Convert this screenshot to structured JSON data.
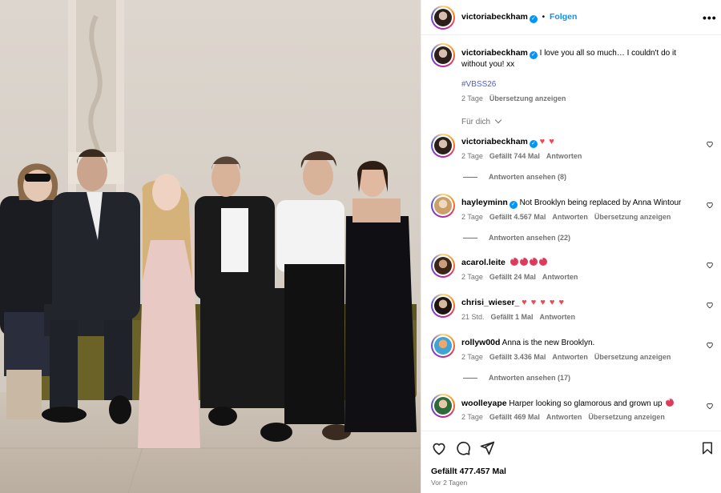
{
  "header": {
    "username": "victoriabeckham",
    "dot": "•",
    "follow_label": "Folgen",
    "more_icon": "more-horizontal-icon"
  },
  "caption": {
    "username": "victoriabeckham",
    "text": "I love you all so much… I couldn't do it without you! xx",
    "hashtag": "#VBSS26",
    "time": "2 Tage",
    "translate_label": "Übersetzung anzeigen"
  },
  "sort": {
    "label": "Für dich"
  },
  "comments": [
    {
      "username": "victoriabeckham",
      "verified": true,
      "text": "",
      "emoji": "♥ ♥",
      "time": "2 Tage",
      "likes": "Gefällt 744 Mal",
      "reply": "Antworten",
      "translate": "",
      "replies": "Antworten ansehen (8)"
    },
    {
      "username": "hayleyminn",
      "verified": true,
      "text": "Not Brooklyn being replaced by Anna Wintour",
      "emoji": "",
      "time": "2 Tage",
      "likes": "Gefällt 4.567 Mal",
      "reply": "Antworten",
      "translate": "Übersetzung anzeigen",
      "replies": "Antworten ansehen (22)"
    },
    {
      "username": "acarol.leite",
      "verified": false,
      "text": "",
      "emoji": "😍😍😍😍",
      "time": "2 Tage",
      "likes": "Gefällt 24 Mal",
      "reply": "Antworten",
      "translate": "",
      "replies": ""
    },
    {
      "username": "chrisi_wieser_",
      "verified": false,
      "text": "",
      "emoji": "♥ ♥ ♥ ♥ ♥",
      "time": "21 Std.",
      "likes": "Gefällt 1 Mal",
      "reply": "Antworten",
      "translate": "",
      "replies": ""
    },
    {
      "username": "rollyw00d",
      "verified": false,
      "text": "Anna is the new Brooklyn.",
      "emoji": "",
      "time": "2 Tage",
      "likes": "Gefällt 3.436 Mal",
      "reply": "Antworten",
      "translate": "Übersetzung anzeigen",
      "replies": "Antworten ansehen (17)"
    },
    {
      "username": "woolleyape",
      "verified": false,
      "text": "Harper looking so glamorous and grown up",
      "emoji": "😍",
      "time": "2 Tage",
      "likes": "Gefällt 469 Mal",
      "reply": "Antworten",
      "translate": "Übersetzung anzeigen",
      "replies": ""
    }
  ],
  "footer": {
    "likes": "Gefällt 477.457 Mal",
    "posted": "Vor 2 Tagen",
    "icons": [
      "heart-icon",
      "comment-icon",
      "share-icon",
      "bookmark-icon"
    ]
  },
  "colors": {
    "accent": "#0095f6",
    "heart": "#ed4956",
    "muted": "#737373",
    "divider": "#efefef"
  }
}
